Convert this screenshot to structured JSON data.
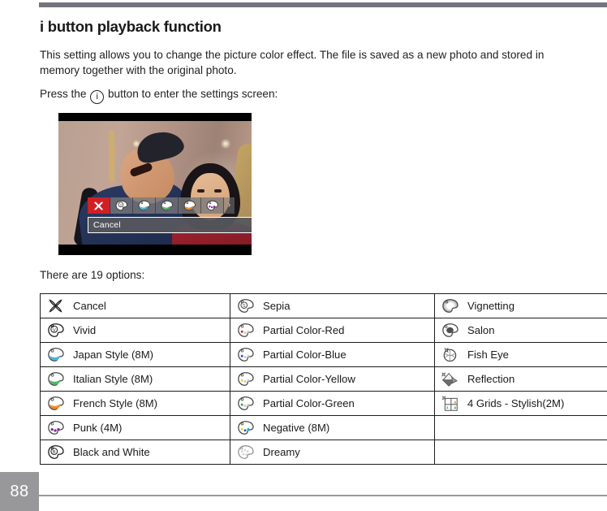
{
  "document": {
    "heading": "i button playback function",
    "paragraph_1": "This setting allows you to change the picture color effect. The file is saved as a new photo and stored in memory together with the original photo.",
    "press_prefix": "Press the",
    "press_icon_label": "i",
    "press_suffix": "button to enter the settings screen:",
    "options_lead": "There are 19 options:",
    "page_number": "88"
  },
  "camera_screen": {
    "cancel_label": "Cancel",
    "next_arrow": "›",
    "toolbar": [
      {
        "name": "cancel",
        "icon": "x-icon",
        "selected": true
      },
      {
        "name": "vivid",
        "icon": "palette-vivid-icon",
        "selected": false
      },
      {
        "name": "japan-style",
        "icon": "palette-blue-icon",
        "selected": false
      },
      {
        "name": "italian-style",
        "icon": "palette-green-icon",
        "selected": false
      },
      {
        "name": "french-style",
        "icon": "palette-orange-icon",
        "selected": false
      },
      {
        "name": "punk",
        "icon": "palette-punk-icon",
        "selected": false
      }
    ]
  },
  "options_table": {
    "rows": [
      [
        {
          "icon": "cancel-x-icon",
          "label": "Cancel"
        },
        {
          "icon": "palette-sepia-icon",
          "label": "Sepia"
        },
        {
          "icon": "palette-vignetting-icon",
          "label": "Vignetting"
        }
      ],
      [
        {
          "icon": "palette-vivid-icon",
          "label": "Vivid"
        },
        {
          "icon": "palette-partial-red-icon",
          "label": "Partial Color-Red"
        },
        {
          "icon": "palette-salon-icon",
          "label": "Salon"
        }
      ],
      [
        {
          "icon": "palette-japan-icon",
          "label": "Japan Style (8M)"
        },
        {
          "icon": "palette-partial-blue-icon",
          "label": "Partial Color-Blue"
        },
        {
          "icon": "fish-eye-icon",
          "label": "Fish Eye"
        }
      ],
      [
        {
          "icon": "palette-italian-icon",
          "label": "Italian Style (8M)"
        },
        {
          "icon": "palette-partial-yellow-icon",
          "label": "Partial Color-Yellow"
        },
        {
          "icon": "reflection-icon",
          "label": "Reflection"
        }
      ],
      [
        {
          "icon": "palette-french-icon",
          "label": "French Style (8M)"
        },
        {
          "icon": "palette-partial-green-icon",
          "label": "Partial Color-Green"
        },
        {
          "icon": "four-grids-icon",
          "label": "4 Grids - Stylish(2M)"
        }
      ],
      [
        {
          "icon": "palette-punk-icon",
          "label": "Punk (4M)"
        },
        {
          "icon": "palette-negative-icon",
          "label": "Negative (8M)"
        },
        {
          "icon": "",
          "label": ""
        }
      ],
      [
        {
          "icon": "palette-bw-icon",
          "label": "Black and White"
        },
        {
          "icon": "palette-dreamy-icon",
          "label": "Dreamy"
        },
        {
          "icon": "",
          "label": ""
        }
      ]
    ]
  },
  "colors": {
    "top_rule": "#73757c",
    "footer_rule": "#9a9a9c",
    "page_number_bg": "#98989a",
    "selected_effect": "#cf2026",
    "toolbar_bg": "rgba(120,120,124,0.78)",
    "text": "#1a1a1a",
    "swatch_blue": "#4bb4e0",
    "swatch_green": "#4cb862",
    "swatch_orange": "#f08a20",
    "swatch_purple": "#7b2d8e",
    "swatch_red": "#e02020",
    "swatch_yellow": "#f0cf20"
  }
}
